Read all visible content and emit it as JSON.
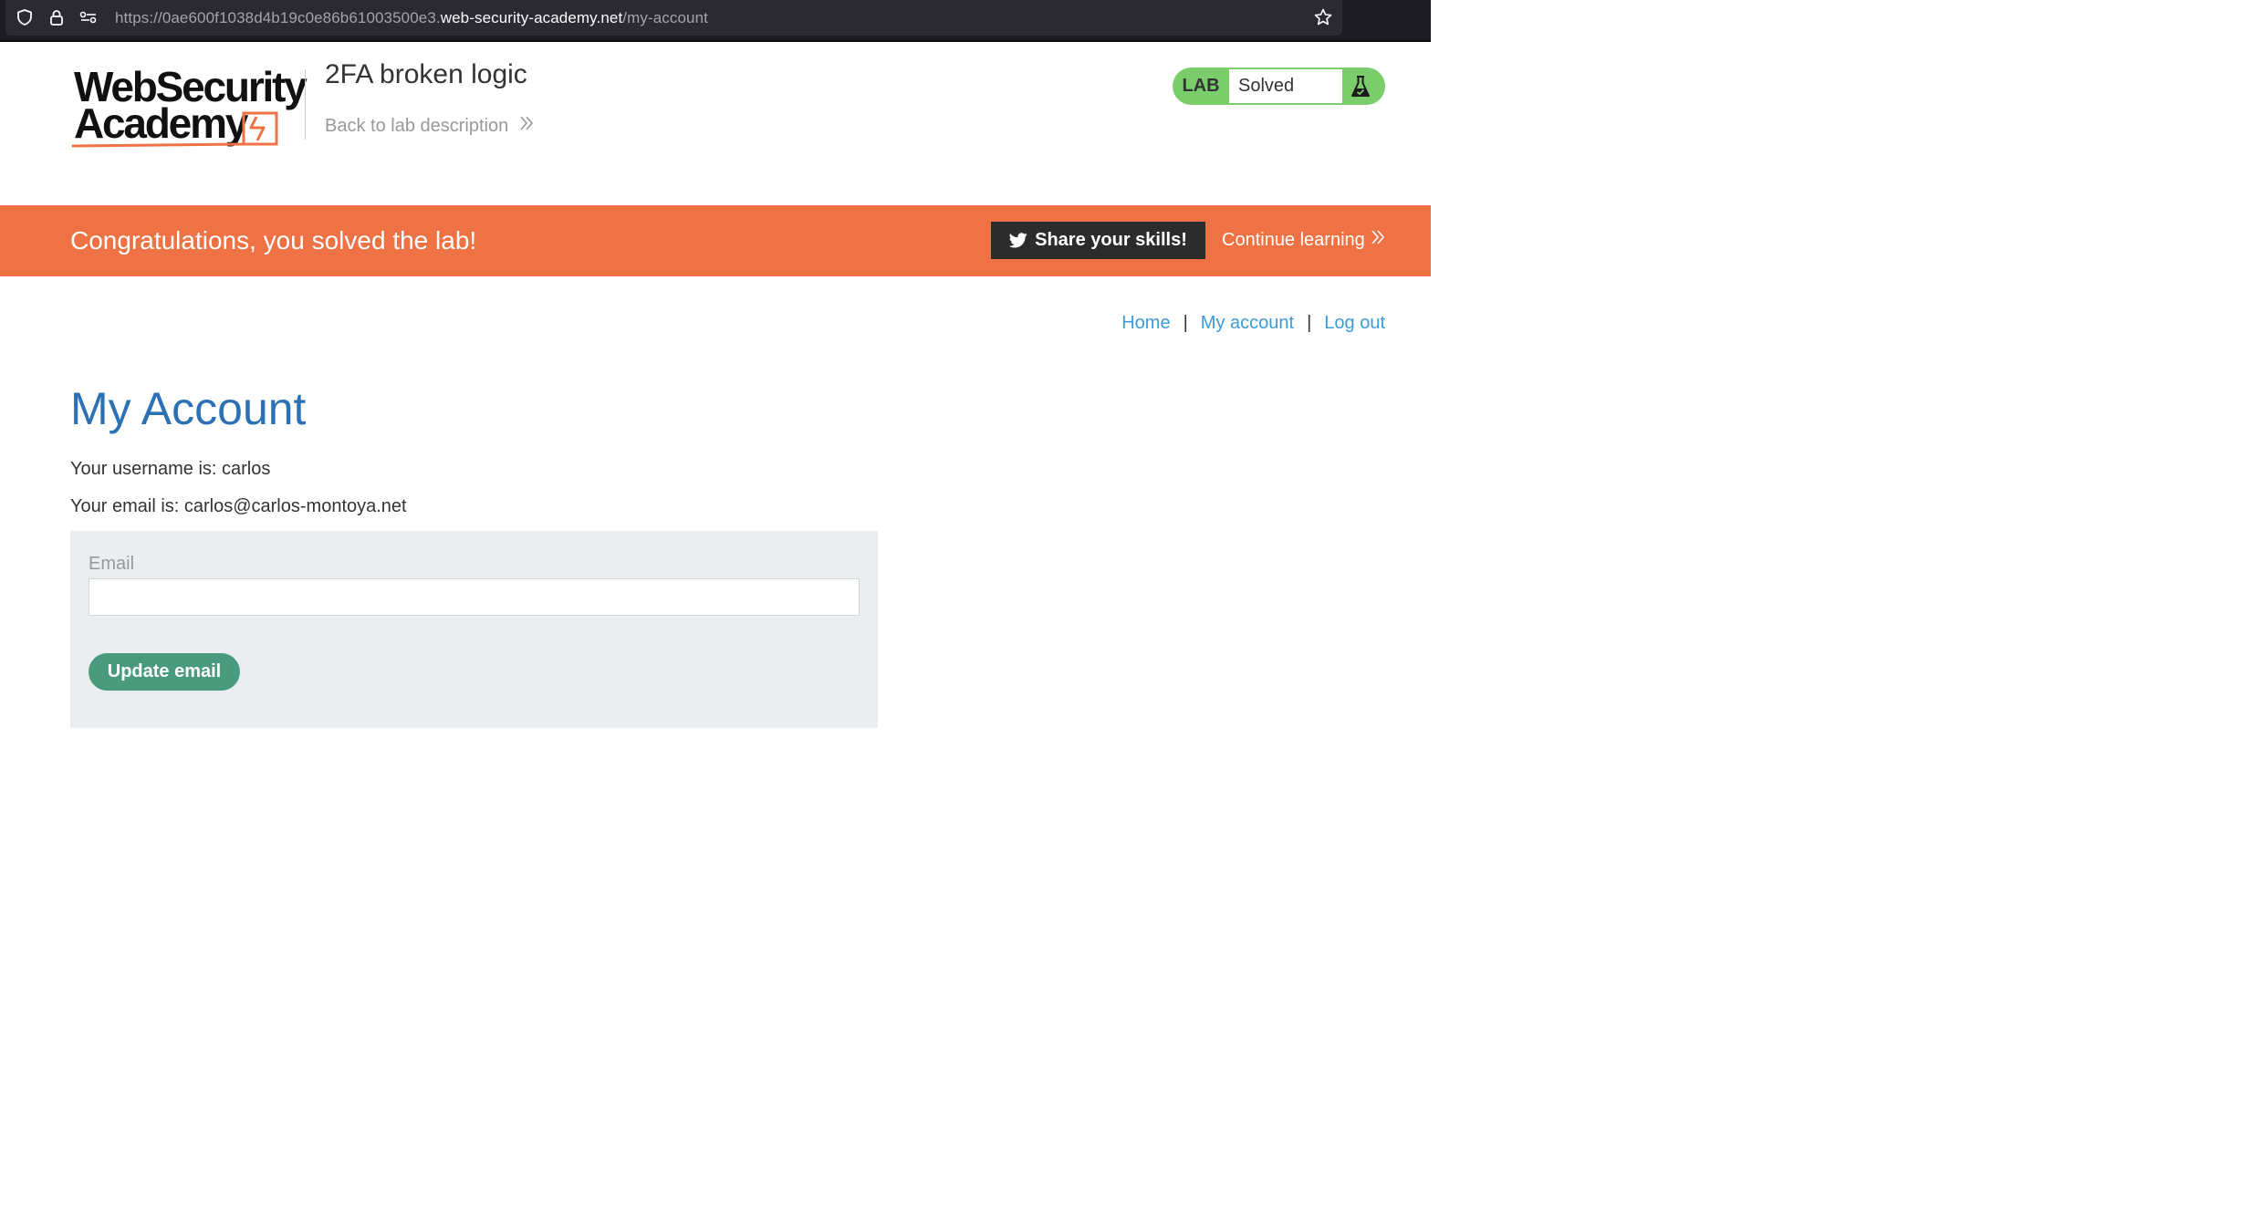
{
  "browser": {
    "url_prefix": "https://0ae600f1038d4b19c0e86b61003500e3.",
    "url_host": "web-security-academy.net",
    "url_path": "/my-account",
    "icons": [
      "shield-icon",
      "lock-icon",
      "site-permissions-icon",
      "bookmark-star-icon"
    ]
  },
  "header": {
    "logo_line1": "WebSecurity",
    "logo_line2": "Academy",
    "lab_title": "2FA broken logic",
    "back_link": "Back to lab description",
    "lab_badge_label": "LAB",
    "lab_status": "Solved",
    "icons": [
      "logo-lightning-icon",
      "flask-icon",
      "double-chevron-right-icon"
    ]
  },
  "banner": {
    "message": "Congratulations, you solved the lab!",
    "share_label": "Share your skills!",
    "continue_label": "Continue learning",
    "icons": [
      "twitter-bird-icon",
      "double-chevron-right-icon"
    ]
  },
  "nav": {
    "items": [
      {
        "label": "Home"
      },
      {
        "label": "My account"
      },
      {
        "label": "Log out"
      }
    ],
    "separator": "|"
  },
  "main": {
    "title": "My Account",
    "username_line": "Your username is: carlos",
    "email_line": "Your email is: carlos@carlos-montoya.net",
    "form": {
      "email_label": "Email",
      "email_value": "",
      "update_button": "Update email"
    }
  },
  "colors": {
    "banner": "#ee7244",
    "badge": "#7bcd6c",
    "title": "#2c71b4",
    "link": "#3d9bd8",
    "update_button": "#4a9a7e",
    "form_background": "#ebeef0"
  }
}
